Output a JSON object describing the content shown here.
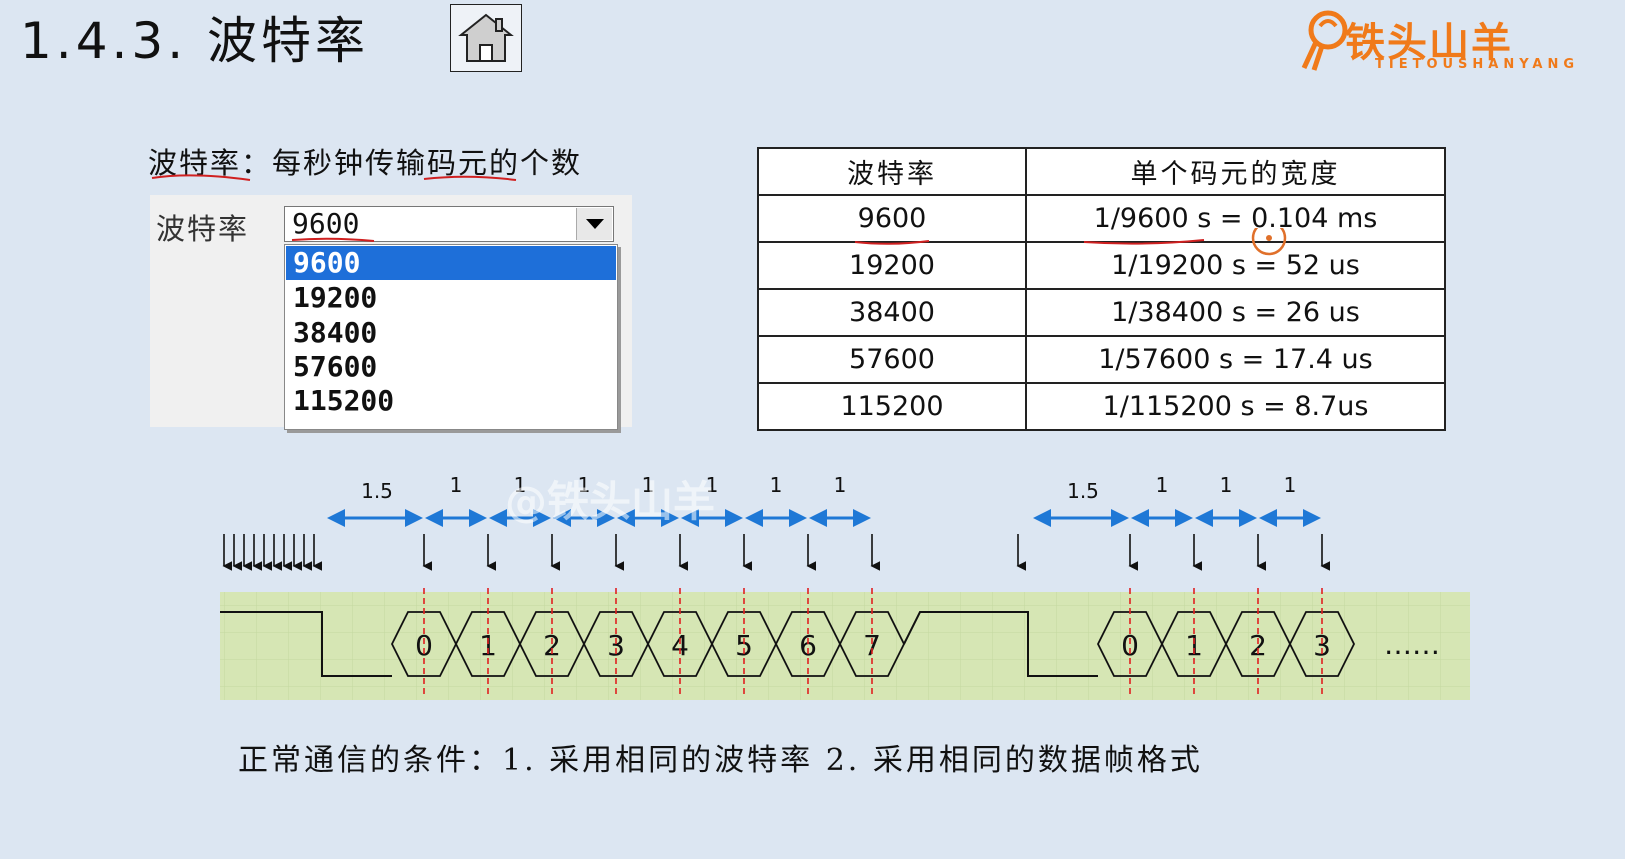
{
  "slide": {
    "title": "1.4.3. 波特率",
    "home_icon": "home-icon"
  },
  "logo": {
    "text": "铁头山羊",
    "sub": "TIETOUSHANYANG",
    "icon": "goat-head-logo",
    "color": "#f07a1a"
  },
  "definition": {
    "text": "波特率：每秒钟传输码元的个数"
  },
  "baud_dialog": {
    "label": "波特率",
    "selected": "9600",
    "options": [
      "9600",
      "19200",
      "38400",
      "57600",
      "115200"
    ],
    "highlight_color": "#1e6fd9"
  },
  "table": {
    "headers": [
      "波特率",
      "单个码元的宽度"
    ],
    "rows": [
      [
        "9600",
        "1/9600  s  =  0.104  ms"
      ],
      [
        "19200",
        "1/19200  s  =  52  us"
      ],
      [
        "38400",
        "1/38400  s  =  26  us"
      ],
      [
        "57600",
        "1/57600  s  =  17.4  us"
      ],
      [
        "115200",
        "1/115200  s  =  8.7us"
      ]
    ]
  },
  "diagram": {
    "frame1": {
      "intervals": [
        "1.5",
        "1",
        "1",
        "1",
        "1",
        "1",
        "1",
        "1"
      ],
      "bits": [
        "0",
        "1",
        "2",
        "3",
        "4",
        "5",
        "6",
        "7"
      ]
    },
    "frame2": {
      "intervals": [
        "1.5",
        "1",
        "1",
        "1"
      ],
      "bits": [
        "0",
        "1",
        "2",
        "3"
      ],
      "ellipsis": "……"
    },
    "watermark": "@铁头山羊",
    "colors": {
      "background": "#d6e6b4",
      "arrow": "#1e78d6",
      "sample_line": "#e02020"
    }
  },
  "conditions": {
    "text": "正常通信的条件：1. 采用相同的波特率 2. 采用相同的数据帧格式"
  }
}
